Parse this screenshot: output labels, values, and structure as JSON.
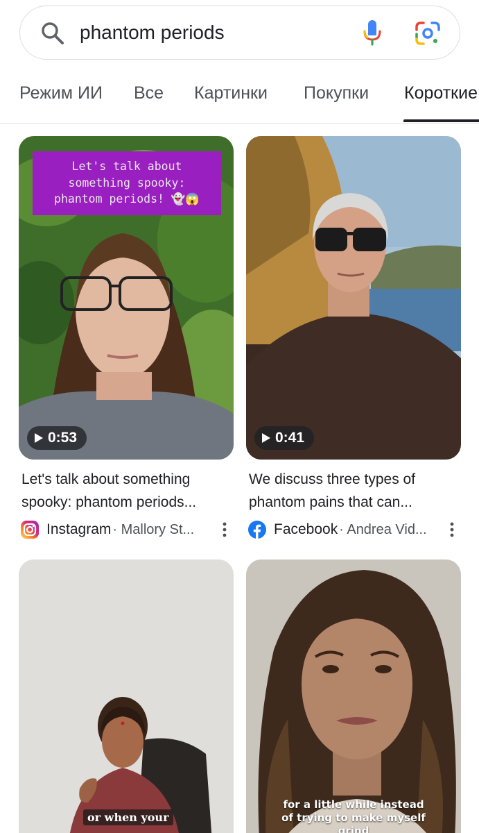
{
  "search": {
    "query": "phantom periods"
  },
  "tabs": [
    {
      "label": "Режим ИИ"
    },
    {
      "label": "Все"
    },
    {
      "label": "Картинки"
    },
    {
      "label": "Покупки"
    },
    {
      "label": "Короткие"
    }
  ],
  "active_tab": "Короткие",
  "cards": [
    {
      "overlay_text": [
        "Let's talk about",
        "something spooky:",
        "phantom periods! 👻😱"
      ],
      "duration": "0:53",
      "title": "Let's talk about something spooky: phantom periods...",
      "source": "Instagram",
      "author": "· Mallory St..."
    },
    {
      "duration": "0:41",
      "title": "We discuss three types of phantom pains that can...",
      "source": "Facebook",
      "author": "· Andrea Vid..."
    },
    {
      "caption": "or when your"
    },
    {
      "caption_lines": [
        "for a little while instead",
        "of trying to make myself",
        "grind"
      ]
    }
  ],
  "colors": {
    "overlay_purple": "#9a1fc0",
    "facebook_blue": "#1877f2",
    "google_blue": "#4285f4",
    "google_red": "#ea4335",
    "google_yellow": "#fbbc04",
    "google_green": "#34a853"
  },
  "icons": [
    "search-icon",
    "mic-icon",
    "google-lens-icon",
    "play-icon",
    "instagram-logo-icon",
    "facebook-logo-icon",
    "more-vert-icon"
  ]
}
